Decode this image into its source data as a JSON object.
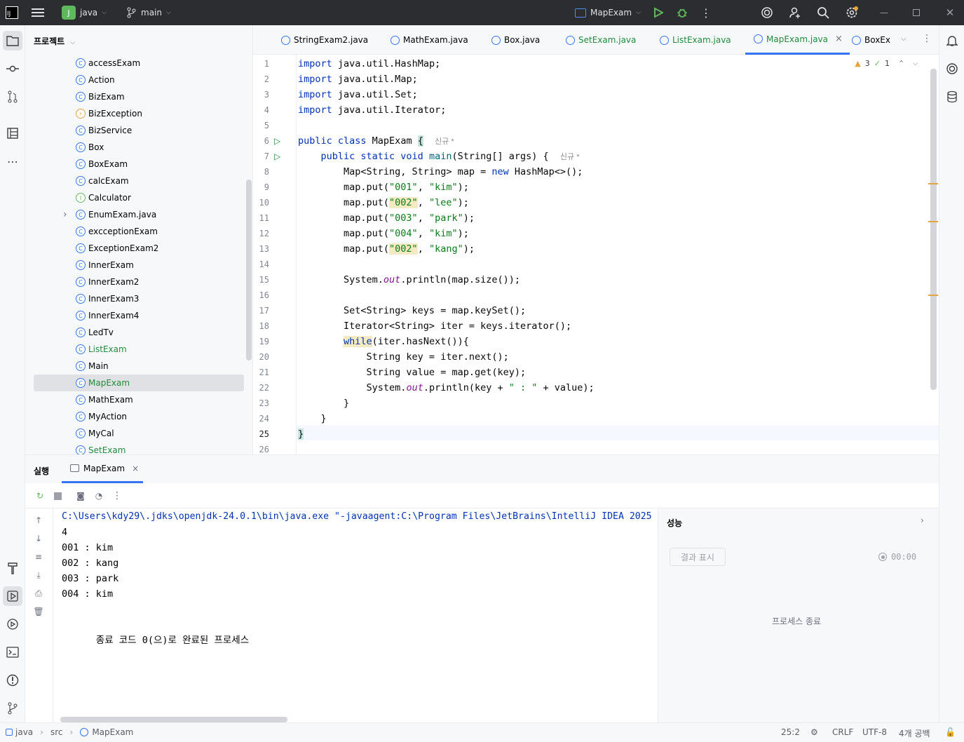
{
  "titlebar": {
    "app_icon": "IJ",
    "project_initial": "J",
    "project_name": "java",
    "branch": "main",
    "run_config": "MapExam",
    "icons": [
      "menu-icon",
      "branch-icon",
      "run-icon",
      "debug-icon",
      "more-icon",
      "ai-assistant-icon",
      "add-user-icon",
      "search-icon",
      "settings-icon",
      "minimize-icon",
      "maximize-icon",
      "close-icon"
    ]
  },
  "project_panel": {
    "title": "프로젝트",
    "items": [
      {
        "label": "accessExam",
        "kind": "class",
        "color": "normal"
      },
      {
        "label": "Action",
        "kind": "class",
        "color": "normal"
      },
      {
        "label": "BizExam",
        "kind": "class",
        "color": "normal"
      },
      {
        "label": "BizException",
        "kind": "exception",
        "color": "normal"
      },
      {
        "label": "BizService",
        "kind": "class",
        "color": "normal"
      },
      {
        "label": "Box",
        "kind": "class",
        "color": "normal"
      },
      {
        "label": "BoxExam",
        "kind": "class",
        "color": "normal"
      },
      {
        "label": "calcExam",
        "kind": "class",
        "color": "normal"
      },
      {
        "label": "Calculator",
        "kind": "interface",
        "color": "normal"
      },
      {
        "label": "EnumExam.java",
        "kind": "class",
        "color": "normal",
        "expandable": true
      },
      {
        "label": "excceptionExam",
        "kind": "class",
        "color": "normal"
      },
      {
        "label": "ExceptionExam2",
        "kind": "class",
        "color": "normal"
      },
      {
        "label": "InnerExam",
        "kind": "class",
        "color": "normal"
      },
      {
        "label": "InnerExam2",
        "kind": "class",
        "color": "normal"
      },
      {
        "label": "InnerExam3",
        "kind": "class",
        "color": "normal"
      },
      {
        "label": "InnerExam4",
        "kind": "class",
        "color": "normal"
      },
      {
        "label": "LedTv",
        "kind": "class",
        "color": "normal"
      },
      {
        "label": "ListExam",
        "kind": "class",
        "color": "green"
      },
      {
        "label": "Main",
        "kind": "class",
        "color": "normal"
      },
      {
        "label": "MapExam",
        "kind": "class",
        "color": "green",
        "selected": true
      },
      {
        "label": "MathExam",
        "kind": "class",
        "color": "normal"
      },
      {
        "label": "MyAction",
        "kind": "class",
        "color": "normal"
      },
      {
        "label": "MyCal",
        "kind": "class",
        "color": "normal"
      },
      {
        "label": "SetExam",
        "kind": "class",
        "color": "green"
      }
    ]
  },
  "editor": {
    "tabs": [
      {
        "label": "StringExam2.java",
        "color": "normal"
      },
      {
        "label": "MathExam.java",
        "color": "normal"
      },
      {
        "label": "Box.java",
        "color": "normal"
      },
      {
        "label": "SetExam.java",
        "color": "green"
      },
      {
        "label": "ListExam.java",
        "color": "green"
      },
      {
        "label": "MapExam.java",
        "color": "green",
        "active": true
      },
      {
        "label": "BoxEx",
        "color": "normal"
      }
    ],
    "warnings": "3",
    "checks": "1",
    "hint_new": "신규 *",
    "current_line": "25",
    "line_numbers": [
      "1",
      "2",
      "3",
      "4",
      "5",
      "6",
      "7",
      "8",
      "9",
      "10",
      "11",
      "12",
      "13",
      "14",
      "15",
      "16",
      "17",
      "18",
      "19",
      "20",
      "21",
      "22",
      "23",
      "24",
      "25",
      "26"
    ]
  },
  "run_panel": {
    "title": "실행",
    "tab": "MapExam",
    "console": {
      "command": "C:\\Users\\kdy29\\.jdks\\openjdk-24.0.1\\bin\\java.exe \"-javaagent:C:\\Program Files\\JetBrains\\IntelliJ IDEA 2025",
      "output": [
        "4",
        "001 : kim",
        "002 : kang",
        "003 : park",
        "004 : kim"
      ],
      "exit_message": "종료 코드 0(으)로 완료된 프로세스"
    },
    "performance": {
      "title": "성능",
      "show_results": "결과 표시",
      "timer": "00:00",
      "status": "프로세스 종료"
    }
  },
  "statusbar": {
    "crumbs": [
      "java",
      "src",
      "MapExam"
    ],
    "position": "25:2",
    "line_sep": "CRLF",
    "encoding": "UTF-8",
    "indent": "4개 공백"
  }
}
